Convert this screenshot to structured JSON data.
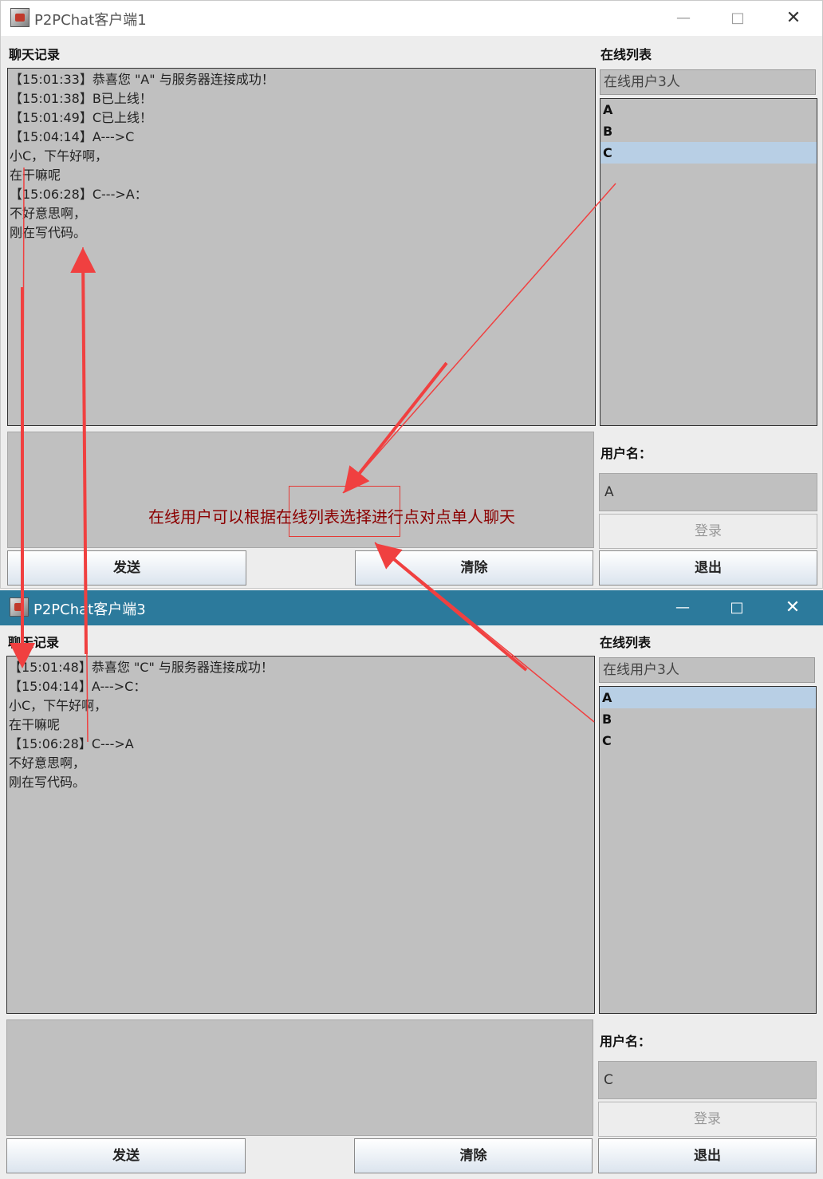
{
  "win1": {
    "title": "P2PChat客户端1",
    "chat_label": "聊天记录",
    "online_label": "在线列表",
    "online_count": "在线用户3人",
    "users": [
      "A",
      "B",
      "C"
    ],
    "selected_user": "C",
    "messages": [
      "【15:01:33】恭喜您 \"A\" 与服务器连接成功！",
      "【15:01:38】B已上线！",
      "【15:01:49】C已上线！",
      "【15:04:14】A--->C",
      "小C，下午好啊，",
      "在干嘛呢",
      "【15:06:28】C--->A：",
      "不好意思啊，",
      "刚在写代码。"
    ],
    "username_label": "用户名：",
    "username_value": "A",
    "login_label": "登录",
    "send_label": "发送",
    "clear_label": "清除",
    "exit_label": "退出"
  },
  "win2": {
    "title": "P2PChat客户端3",
    "chat_label": "聊天记录",
    "online_label": "在线列表",
    "online_count": "在线用户3人",
    "users": [
      "A",
      "B",
      "C"
    ],
    "selected_user": "A",
    "messages": [
      "【15:01:48】恭喜您 \"C\" 与服务器连接成功！",
      "【15:04:14】A--->C：",
      "小C，下午好啊，",
      "在干嘛呢",
      "【15:06:28】C--->A",
      "不好意思啊，",
      "刚在写代码。"
    ],
    "username_label": "用户名：",
    "username_value": "C",
    "login_label": "登录",
    "send_label": "发送",
    "clear_label": "清除",
    "exit_label": "退出"
  },
  "annotation": {
    "text": "在线用户可以根据在线列表选择进行点对点单人聊天",
    "color": "#8b0000",
    "arrow_color": "#f04040"
  },
  "icons": {
    "minimize": "minimize-icon",
    "maximize": "maximize-icon",
    "close": "close-icon"
  }
}
